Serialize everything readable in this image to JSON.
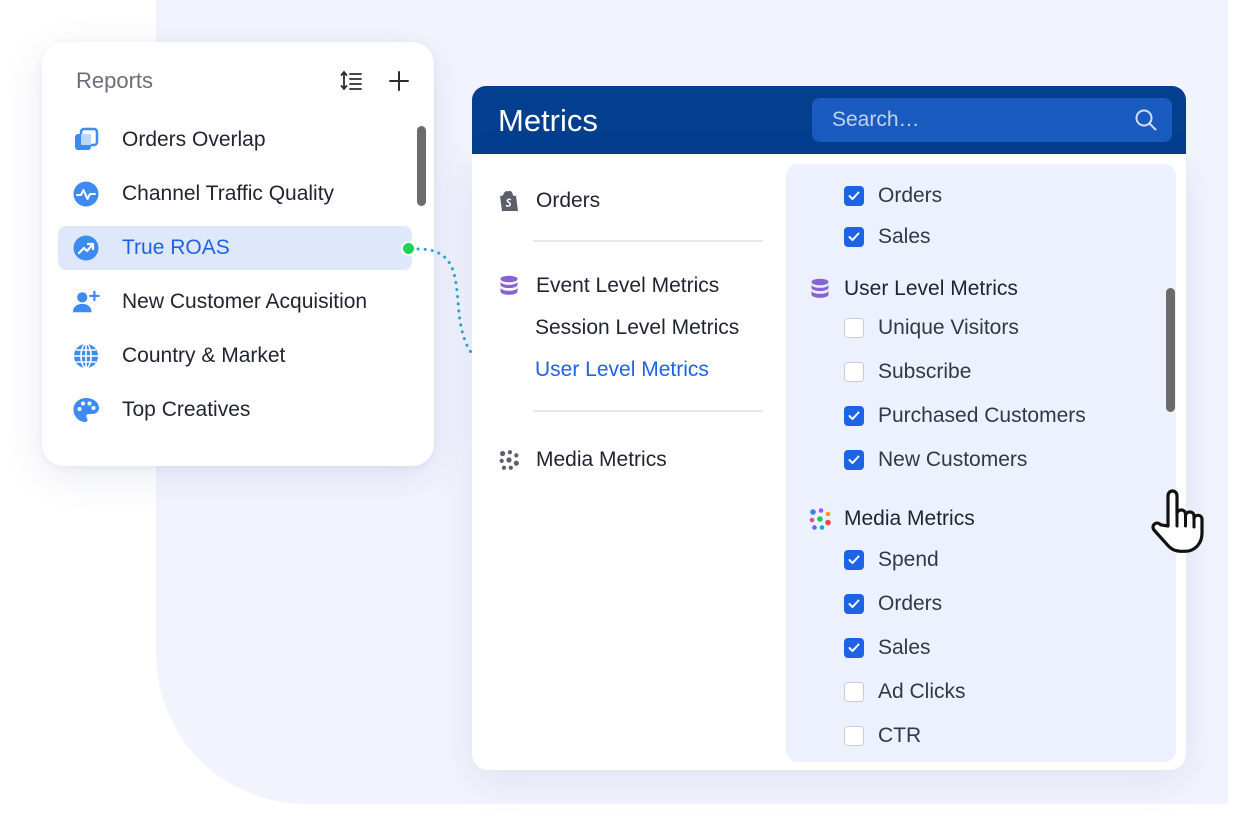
{
  "reports": {
    "title": "Reports",
    "items": [
      {
        "label": "Orders Overlap",
        "icon": "overlap-icon"
      },
      {
        "label": "Channel Traffic Quality",
        "icon": "pulse-icon"
      },
      {
        "label": "True ROAS",
        "icon": "trend-up-icon",
        "active": true
      },
      {
        "label": "New Customer Acquisition",
        "icon": "add-user-icon"
      },
      {
        "label": "Country & Market",
        "icon": "globe-icon"
      },
      {
        "label": "Top Creatives",
        "icon": "palette-icon"
      }
    ]
  },
  "metrics": {
    "title": "Metrics",
    "search_placeholder": "Search…",
    "categories": {
      "orders": "Orders",
      "event_level": "Event Level Metrics",
      "session_level": "Session Level Metrics",
      "user_level": "User Level Metrics",
      "media": "Media Metrics"
    },
    "orders_section": {
      "items": [
        {
          "label": "Orders",
          "checked": true
        },
        {
          "label": "Sales",
          "checked": true
        }
      ]
    },
    "user_level_section": {
      "title": "User Level Metrics",
      "items": [
        {
          "label": "Unique Visitors",
          "checked": false
        },
        {
          "label": "Subscribe",
          "checked": false
        },
        {
          "label": "Purchased Customers",
          "checked": true
        },
        {
          "label": "New Customers",
          "checked": true
        }
      ]
    },
    "media_section": {
      "title": "Media Metrics",
      "items": [
        {
          "label": "Spend",
          "checked": true
        },
        {
          "label": "Orders",
          "checked": true
        },
        {
          "label": "Sales",
          "checked": true
        },
        {
          "label": "Ad Clicks",
          "checked": false
        },
        {
          "label": "CTR",
          "checked": false
        }
      ]
    }
  },
  "colors": {
    "accent": "#1e63e6",
    "header": "#043e8e",
    "connector": "#1fd35a"
  }
}
